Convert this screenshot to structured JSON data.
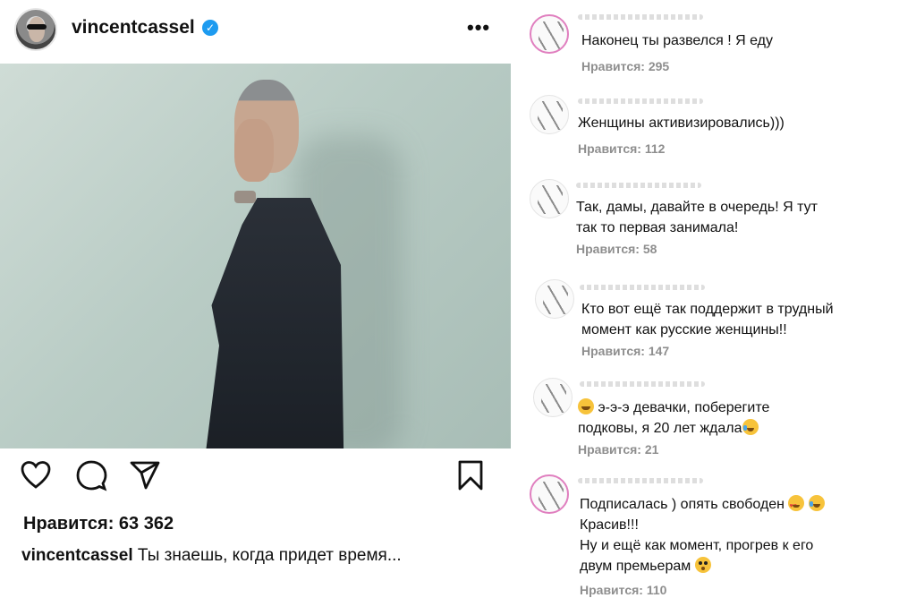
{
  "post": {
    "username": "vincentcassel",
    "more_label": "•••",
    "likes_label": "Нравится: 63 362",
    "caption_user": "vincentcassel",
    "caption_text": " Ты знаешь, когда придет время..."
  },
  "icons": {
    "like": "heart-icon",
    "comment": "comment-icon",
    "share": "paper-plane-icon",
    "save": "bookmark-icon",
    "verified": "verified-badge-icon"
  },
  "colors": {
    "verified": "#1d9bf0",
    "meta_text": "#8e8e8e"
  },
  "comments": [
    {
      "lines": [
        "Наконец ты развелся ! Я еду"
      ],
      "likes": "Нравится: 295"
    },
    {
      "lines": [
        "Женщины активизировались)))"
      ],
      "likes": "Нравится: 112"
    },
    {
      "lines": [
        "Так, дамы, давайте в очередь! Я тут",
        "так то первая занимала!"
      ],
      "likes": "Нравится: 58"
    },
    {
      "lines": [
        "Кто вот ещё так поддержит в трудный",
        "момент как русские женщины!!"
      ],
      "likes": "Нравится: 147"
    },
    {
      "lines": [
        "э-э-э девачки, поберегите",
        "подковы, я 20 лет ждала"
      ],
      "likes": "Нравится: 21"
    },
    {
      "lines": [
        "Подписалась ) опять свободен",
        "Красив!!!",
        "Ну и ещё как момент, прогрев к его",
        "двум премьерам"
      ],
      "likes": "Нравится: 110"
    }
  ]
}
